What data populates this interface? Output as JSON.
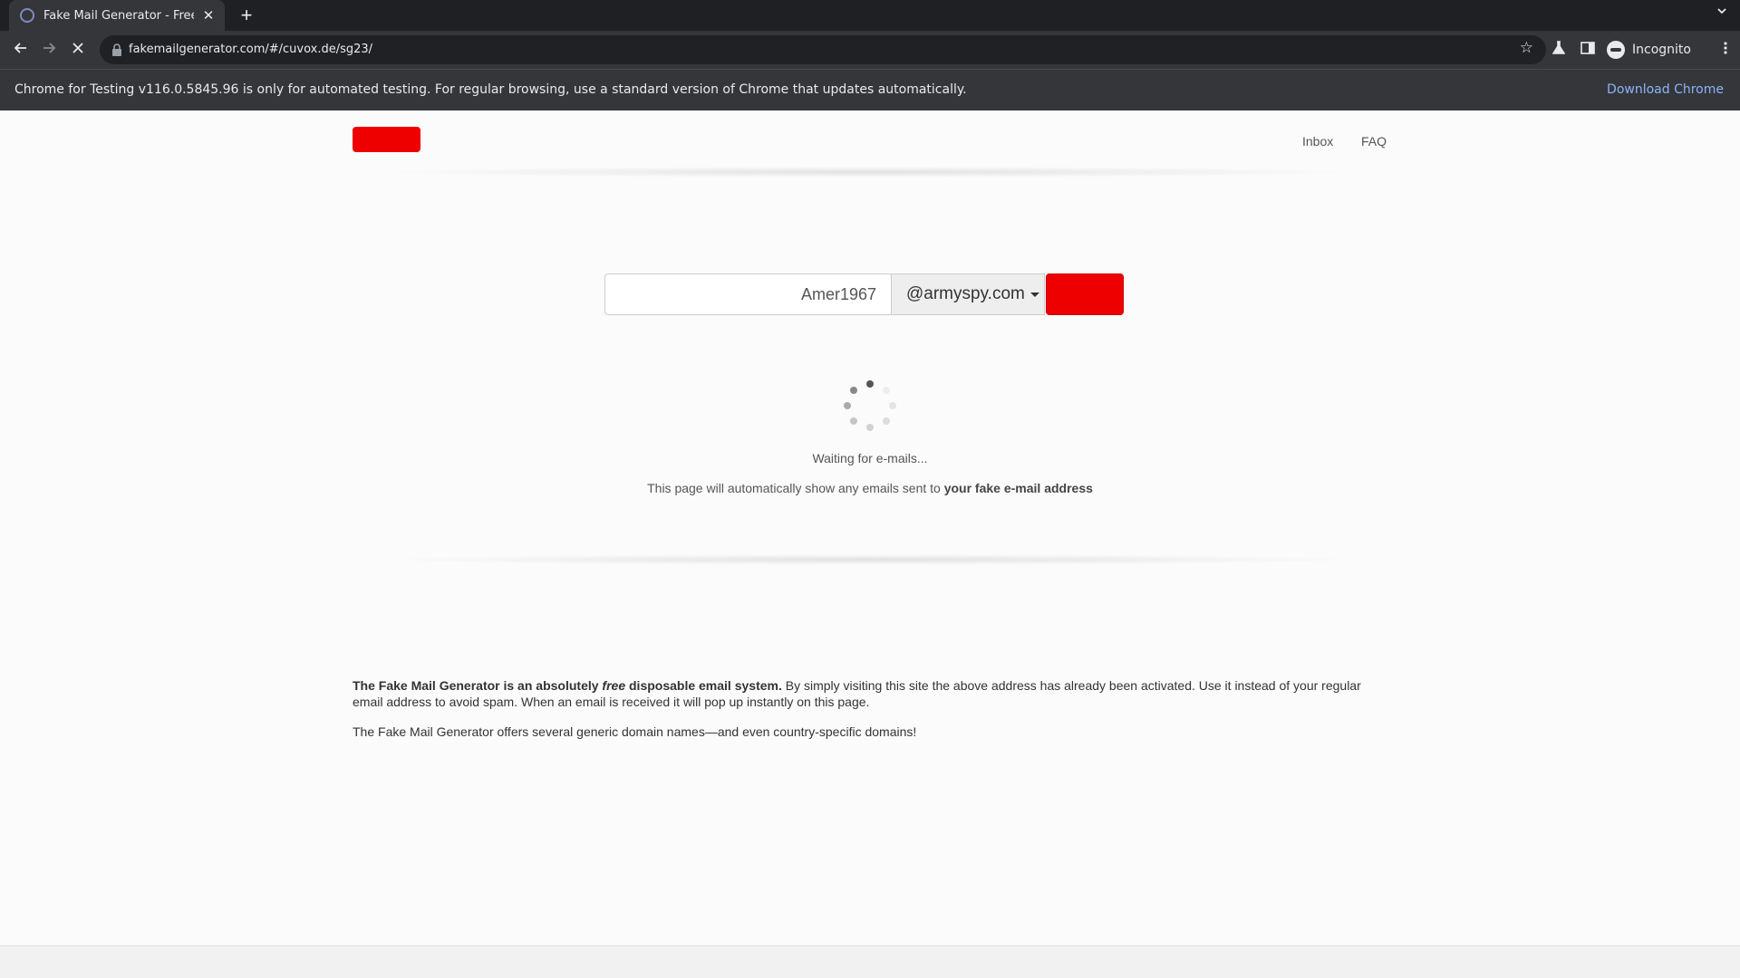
{
  "browser": {
    "tab_title": "Fake Mail Generator - Free",
    "tab_close": "✕",
    "new_tab": "+",
    "url": "fakemailgenerator.com/#/cuvox.de/sg23/",
    "profile_label": "Incognito",
    "infobar_text": "Chrome for Testing v116.0.5845.96 is only for automated testing. For regular browsing, use a standard version of Chrome that updates automatically.",
    "infobar_link": "Download Chrome"
  },
  "nav": {
    "inbox": "Inbox",
    "faq": "FAQ"
  },
  "form": {
    "username": "Amer1967",
    "domain": "@armyspy.com"
  },
  "status": {
    "waiting": "Waiting for e-mails...",
    "hint_prefix": "This page will automatically show any emails sent to ",
    "hint_bold": "your fake e-mail address"
  },
  "about": {
    "p1_bold_a": "The Fake Mail Generator is an absolutely ",
    "p1_italic": "free",
    "p1_bold_b": " disposable email system.",
    "p1_rest": " By simply visiting this site the above address has already been activated. Use it instead of your regular email address to avoid spam. When an email is received it will pop up instantly on this page.",
    "p2": "The Fake Mail Generator offers several generic domain names—and even country-specific domains!"
  },
  "colors": {
    "brand_red": "#ee0000",
    "chrome_dark": "#35363a",
    "link_blue": "#8ab4f8"
  }
}
